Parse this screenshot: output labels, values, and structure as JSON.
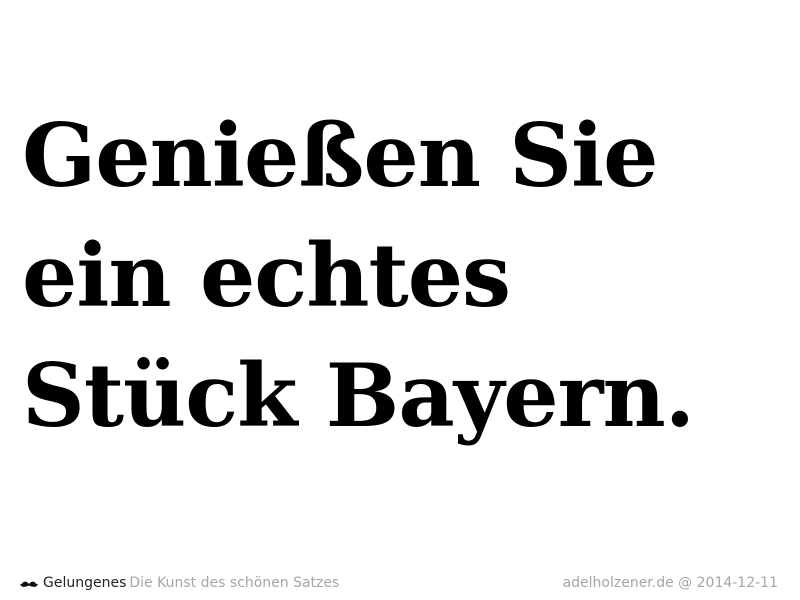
{
  "headline": {
    "lines": [
      "Genießen Sie",
      "ein echtes",
      "Stück Bayern."
    ]
  },
  "footer": {
    "icon": "mustache-icon",
    "brand": "Gelungenes",
    "tagline": "Die Kunst des schönen Satzes",
    "site_date": "adelholzener.de @ 2014-12-11"
  }
}
